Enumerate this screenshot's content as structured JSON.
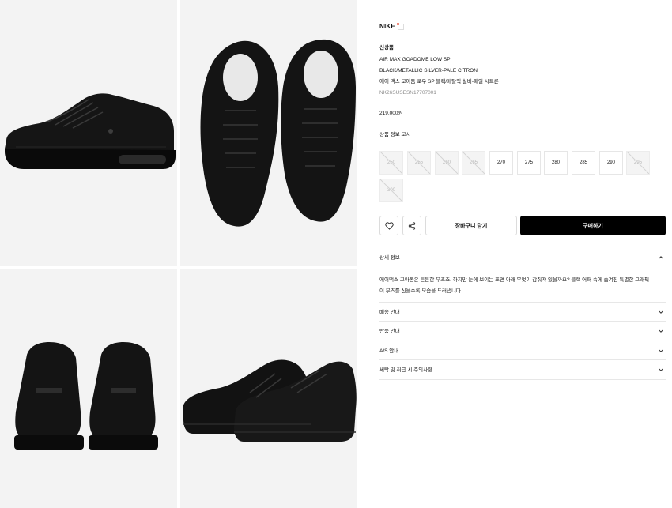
{
  "gallery": {
    "images": [
      "shoe-side-view",
      "shoe-top-view",
      "shoe-back-view",
      "shoe-pair-angle-view"
    ]
  },
  "product": {
    "brand": "NIKE",
    "badge": "신상품",
    "model": "AIR MAX GOADOME LOW SP",
    "color_en": "BLACK/METALLIC SILVER-PALE CITRON",
    "name_ko": "에어 맥스 고아돔 로우 SP 블랙/메탈릭 실버-페일 시트론",
    "code": "NK26SUSESN17707001",
    "price": "219,000원",
    "notice_link": "상품 정보 고시"
  },
  "sizes": [
    {
      "label": "250",
      "available": false
    },
    {
      "label": "255",
      "available": false
    },
    {
      "label": "260",
      "available": false
    },
    {
      "label": "265",
      "available": false
    },
    {
      "label": "270",
      "available": true
    },
    {
      "label": "275",
      "available": true
    },
    {
      "label": "280",
      "available": true
    },
    {
      "label": "285",
      "available": true
    },
    {
      "label": "290",
      "available": true
    },
    {
      "label": "295",
      "available": false
    },
    {
      "label": "300",
      "available": false
    }
  ],
  "actions": {
    "wishlist_icon": "heart-icon",
    "share_icon": "share-icon",
    "cart_label": "장바구니 담기",
    "buy_label": "구매하기"
  },
  "accordion": {
    "detail_title": "상세 정보",
    "detail_body_line1": "에어맥스 고아돔은 튼튼한 부츠죠. 하지만 눈에 보이는 표면 아래 무엇이 감춰져 있을까요? 블랙 어퍼 속에 숨겨진 특별한 그래픽",
    "detail_body_line2": "이 부츠를 신을수록 모습을 드러냅니다.",
    "shipping_title": "배송 안내",
    "returns_title": "반품 안내",
    "as_title": "A/S 안내",
    "care_title": "세탁 및 취급 시 주의사항"
  },
  "colors": {
    "tile_bg": "#f3f3f3",
    "buy_bg": "#000000",
    "sold_bg": "#f4f4f4",
    "brand_dot": "#e8412c"
  }
}
